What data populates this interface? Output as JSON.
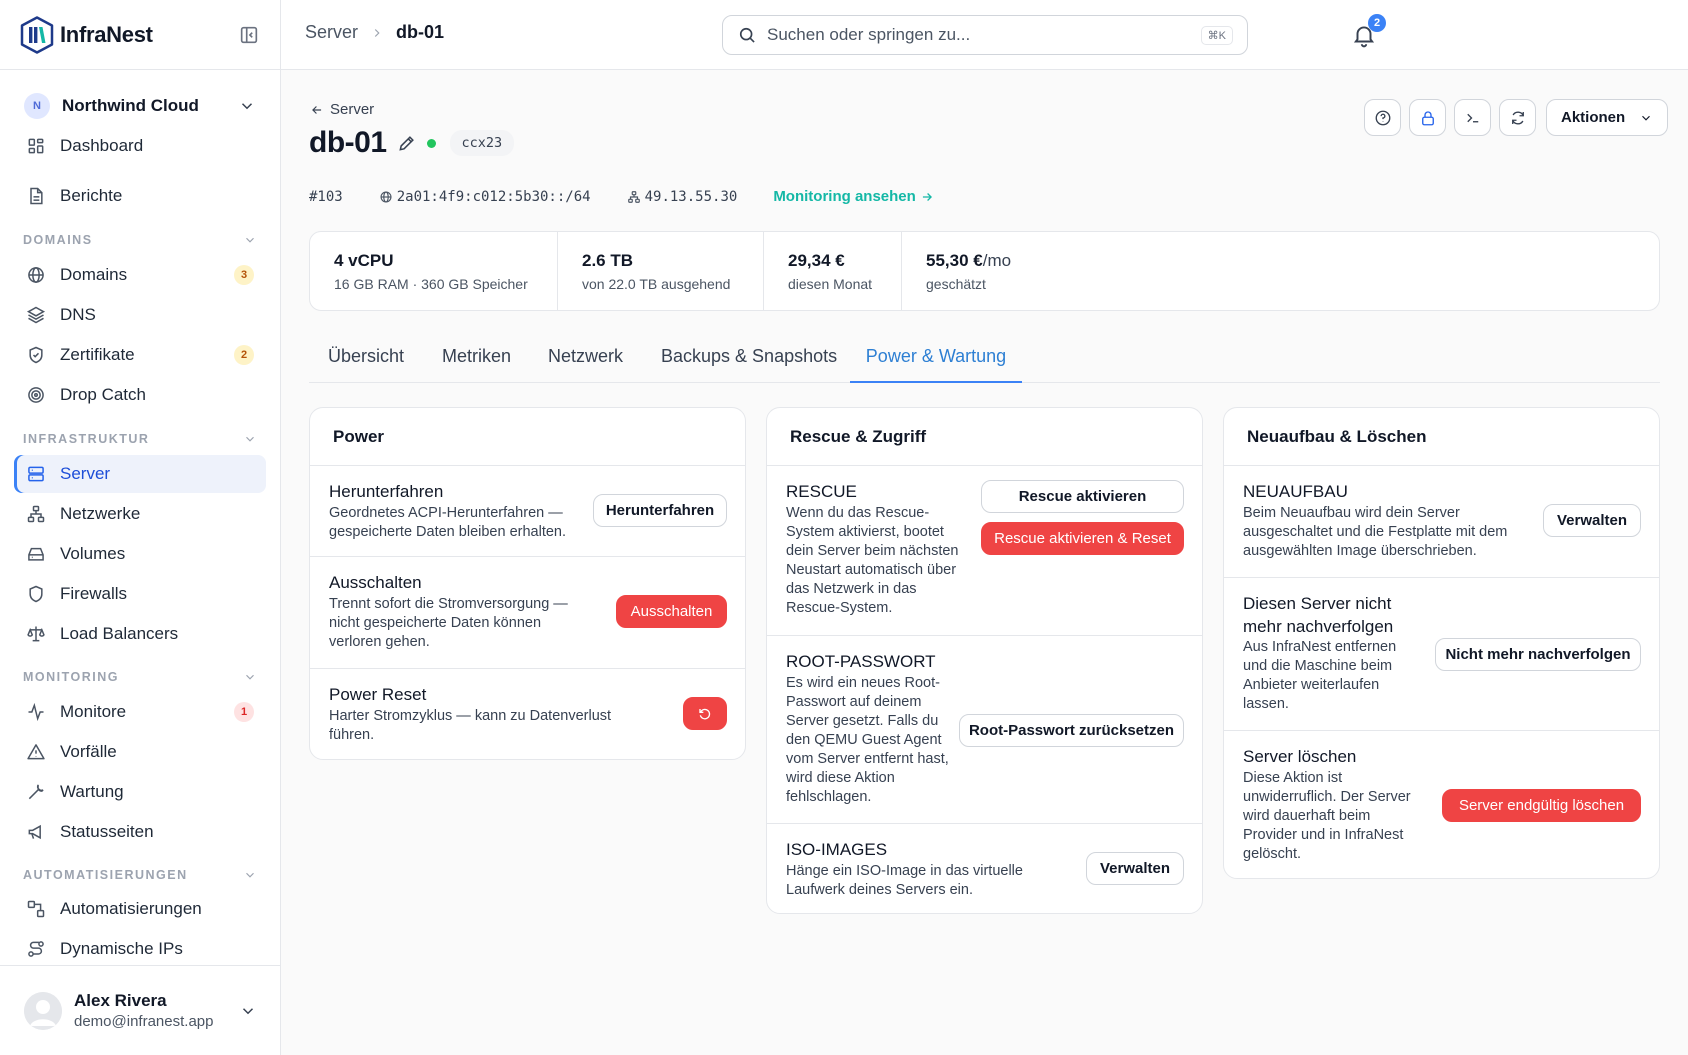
{
  "brand": {
    "name": "InfraNest"
  },
  "org": {
    "initial": "N",
    "name": "Northwind Cloud"
  },
  "nav": {
    "dashboard": "Dashboard",
    "reports": "Berichte",
    "sec_domains": "DOMAINS",
    "domains": "Domains",
    "domains_badge": "3",
    "dns": "DNS",
    "certificates": "Zertifikate",
    "certificates_badge": "2",
    "drop_catch": "Drop Catch",
    "sec_infra": "INFRASTRUKTUR",
    "server": "Server",
    "networks": "Netzwerke",
    "volumes": "Volumes",
    "firewalls": "Firewalls",
    "load_balancers": "Load Balancers",
    "sec_monitoring": "MONITORING",
    "monitors": "Monitore",
    "monitors_badge": "1",
    "incidents": "Vorfälle",
    "maintenance": "Wartung",
    "status_pages": "Statusseiten",
    "sec_automation": "AUTOMATISIERUNGEN",
    "automations": "Automatisierungen",
    "dynamic_ips": "Dynamische IPs"
  },
  "user": {
    "name": "Alex Rivera",
    "email": "demo@infranest.app"
  },
  "topbar": {
    "crumb_parent": "Server",
    "crumb_current": "db-01",
    "search_placeholder": "Suchen oder springen zu...",
    "search_shortcut": "⌘K",
    "notifications_count": "2"
  },
  "header": {
    "back_label": "Server",
    "title": "db-01",
    "server_type": "ccx23",
    "actions_label": "Aktionen"
  },
  "meta": {
    "id": "#103",
    "ipv6": "2a01:4f9:c012:5b30::/64",
    "ipv4": "49.13.55.30",
    "monitoring_link": "Monitoring ansehen"
  },
  "stats": [
    {
      "value": "4 vCPU",
      "unit": "",
      "sub": "16 GB RAM · 360 GB Speicher"
    },
    {
      "value": "2.6 TB",
      "unit": "",
      "sub": "von 22.0 TB ausgehend"
    },
    {
      "value": "29,34 €",
      "unit": "",
      "sub": "diesen Monat"
    },
    {
      "value": "55,30 €",
      "unit": "/mo",
      "sub": "geschätzt"
    }
  ],
  "tabs": [
    "Übersicht",
    "Metriken",
    "Netzwerk",
    "Backups & Snapshots",
    "Power & Wartung"
  ],
  "power": {
    "title": "Power",
    "shutdown": {
      "title": "Herunterfahren",
      "desc": "Geordnetes ACPI-Herunterfahren — gespeicherte Daten bleiben erhalten.",
      "button": "Herunterfahren"
    },
    "poweroff": {
      "title": "Ausschalten",
      "desc": "Trennt sofort die Stromversorgung — nicht gespeicherte Daten können verloren gehen.",
      "button": "Ausschalten"
    },
    "reset": {
      "title": "Power Reset",
      "desc": "Harter Stromzyklus — kann zu Datenverlust führen."
    }
  },
  "rescue": {
    "title": "Rescue & Zugriff",
    "rescue": {
      "title": "RESCUE",
      "desc": "Wenn du das Rescue-System aktivierst, bootet dein Server beim nächsten Neustart automatisch über das Netzwerk in das Rescue-System.",
      "button": "Rescue aktivieren",
      "button_reset": "Rescue aktivieren & Reset"
    },
    "root": {
      "title": "ROOT-PASSWORT",
      "desc": "Es wird ein neues Root-Passwort auf deinem Server gesetzt. Falls du den QEMU Guest Agent vom Server entfernt hast, wird diese Aktion fehlschlagen.",
      "button": "Root-Passwort zurücksetzen"
    },
    "iso": {
      "title": "ISO-IMAGES",
      "desc": "Hänge ein ISO-Image in das virtuelle Laufwerk deines Servers ein.",
      "button": "Verwalten"
    }
  },
  "rebuild": {
    "title": "Neuaufbau & Löschen",
    "rebuild": {
      "title": "NEUAUFBAU",
      "desc": "Beim Neuaufbau wird dein Server ausgeschaltet und die Festplatte mit dem ausgewählten Image überschrieben.",
      "button": "Verwalten"
    },
    "untrack": {
      "title": "Diesen Server nicht mehr nachverfolgen",
      "desc": "Aus InfraNest entfernen und die Maschine beim Anbieter weiterlaufen lassen.",
      "button": "Nicht mehr nachverfolgen"
    },
    "delete": {
      "title": "Server löschen",
      "desc": "Diese Aktion ist unwiderruflich. Der Server wird dauerhaft beim Provider und in InfraNest gelöscht.",
      "button": "Server endgültig löschen"
    }
  },
  "colors": {
    "accent": "#3b82f6",
    "danger": "#ef4444",
    "teal": "#14b8a6",
    "status_online": "#22c55e"
  }
}
